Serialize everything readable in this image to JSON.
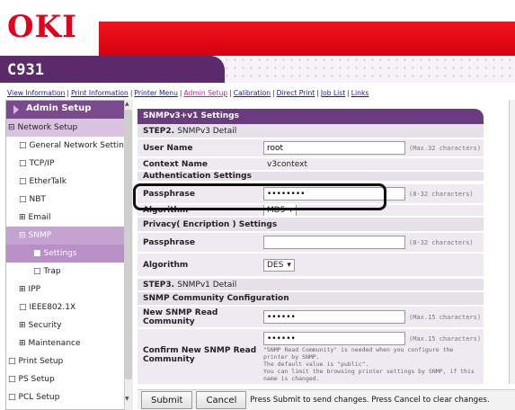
{
  "header": {
    "logo": "OKI",
    "model": "C931"
  },
  "nav": {
    "links": [
      "View Information",
      "Print Information",
      "Printer Menu",
      "Admin Setup",
      "Calibration",
      "Direct Print",
      "Job List",
      "Links"
    ],
    "active": "Admin Setup"
  },
  "sidebar": {
    "title": "Admin Setup",
    "items": [
      {
        "prefix": "⊟",
        "label": "Network Setup",
        "level": 0,
        "state": "hl"
      },
      {
        "prefix": "□",
        "label": "General Network Setting",
        "level": 1,
        "state": ""
      },
      {
        "prefix": "□",
        "label": "TCP/IP",
        "level": 1,
        "state": ""
      },
      {
        "prefix": "□",
        "label": "EtherTalk",
        "level": 1,
        "state": ""
      },
      {
        "prefix": "□",
        "label": "NBT",
        "level": 1,
        "state": ""
      },
      {
        "prefix": "⊞",
        "label": "Email",
        "level": 1,
        "state": ""
      },
      {
        "prefix": "⊟",
        "label": "SNMP",
        "level": 1,
        "state": "sel2"
      },
      {
        "prefix": "■",
        "label": "Settings",
        "level": 2,
        "state": "sel"
      },
      {
        "prefix": "□",
        "label": "Trap",
        "level": 2,
        "state": ""
      },
      {
        "prefix": "⊞",
        "label": "IPP",
        "level": 1,
        "state": ""
      },
      {
        "prefix": "□",
        "label": "IEEE802.1X",
        "level": 1,
        "state": ""
      },
      {
        "prefix": "⊞",
        "label": "Security",
        "level": 1,
        "state": ""
      },
      {
        "prefix": "⊞",
        "label": "Maintenance",
        "level": 1,
        "state": ""
      },
      {
        "prefix": "□",
        "label": "Print Setup",
        "level": 0,
        "state": ""
      },
      {
        "prefix": "□",
        "label": "PS Setup",
        "level": 0,
        "state": ""
      },
      {
        "prefix": "□",
        "label": "PCL Setup",
        "level": 0,
        "state": ""
      }
    ]
  },
  "main": {
    "section_title": "SNMPv3+v1 Settings",
    "step2": {
      "step": "STEP2.",
      "text": "SNMPv3 Detail"
    },
    "user_name": {
      "label": "User Name",
      "value": "root",
      "hint": "(Max.32 characters)"
    },
    "context_name": {
      "label": "Context Name",
      "value": "v3context"
    },
    "auth_settings": "Authentication Settings",
    "passphrase_auth": {
      "label": "Passphrase",
      "value": "••••••••",
      "hint": "(8-32 characters)"
    },
    "algorithm_auth": {
      "label": "Algorithm",
      "value": "MD5"
    },
    "privacy_settings": "Privacy( Encription ) Settings",
    "passphrase_priv": {
      "label": "Passphrase",
      "value": "",
      "hint": "(8-32 characters)"
    },
    "algorithm_priv": {
      "label": "Algorithm",
      "value": "DES"
    },
    "step3": {
      "step": "STEP3.",
      "text": "SNMPv1 Detail"
    },
    "community_config": "SNMP Community Configuration",
    "new_read": {
      "label": "New SNMP Read Community",
      "value": "••••••",
      "hint": "(Max.15 characters)"
    },
    "confirm_read": {
      "label": "Confirm New SNMP Read Community",
      "value": "••••••",
      "hint": "(Max.15 characters)",
      "note": "\"SNMP Read Community\" is needed when you configure the printer by SNMP.\nThe default value is \"public\".\nYou can limit the browsing printer settings by SNMP, if this name is changed."
    }
  },
  "footer": {
    "submit": "Submit",
    "cancel": "Cancel",
    "message": "Press Submit to send changes. Press Cancel to clear changes."
  },
  "colors": {
    "brand_red": "#e2001a",
    "brand_purple": "#5a2a6a"
  }
}
